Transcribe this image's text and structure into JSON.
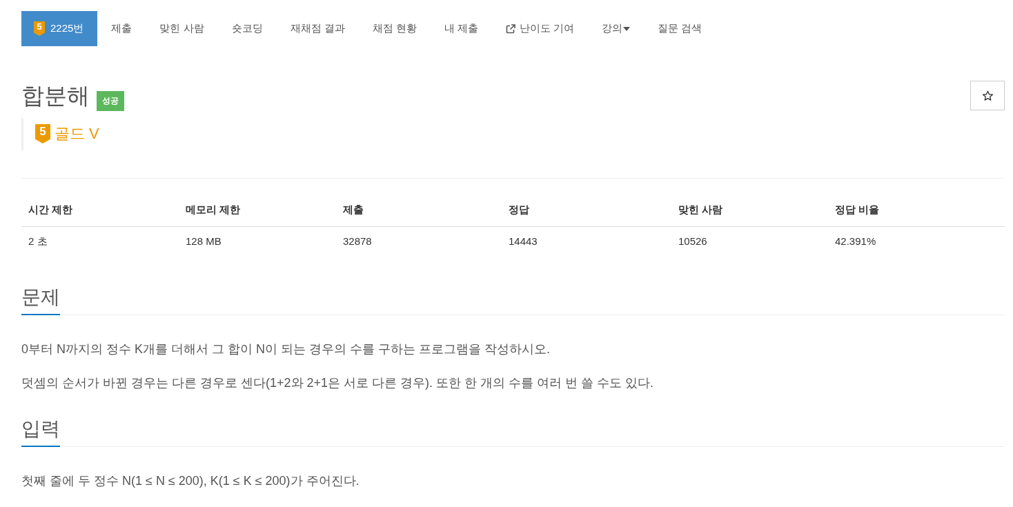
{
  "nav": {
    "tabs": [
      {
        "label": "2225번",
        "badge": "5",
        "kind": "problem",
        "selected": true
      },
      {
        "label": "제출",
        "kind": "link",
        "selected": false
      },
      {
        "label": "맞힌 사람",
        "kind": "link",
        "selected": false
      },
      {
        "label": "숏코딩",
        "kind": "link",
        "selected": false
      },
      {
        "label": "재채점 결과",
        "kind": "link",
        "selected": false
      },
      {
        "label": "채점 현황",
        "kind": "link",
        "selected": false
      },
      {
        "label": "내 제출",
        "kind": "link",
        "selected": false
      },
      {
        "label": "난이도 기여",
        "kind": "external",
        "selected": false
      },
      {
        "label": "강의",
        "kind": "dropdown",
        "selected": false
      },
      {
        "label": "질문 검색",
        "kind": "link",
        "selected": false
      }
    ]
  },
  "problem": {
    "title": "합분해",
    "result": "성공",
    "starred": false,
    "tier": {
      "badge": "5",
      "name": "골드 V"
    }
  },
  "info_table": {
    "columns": [
      "시간 제한",
      "메모리 제한",
      "제출",
      "정답",
      "맞힌 사람",
      "정답 비율"
    ],
    "rows": [
      [
        "2 초",
        "128 MB",
        "32878",
        "14443",
        "10526",
        "42.391%"
      ]
    ]
  },
  "sections": [
    {
      "heading": "문제",
      "paragraphs": [
        "0부터 N까지의 정수 K개를 더해서 그 합이 N이 되는 경우의 수를 구하는 프로그램을 작성하시오.",
        "덧셈의 순서가 바뀐 경우는 다른 경우로 센다(1+2와 2+1은 서로 다른 경우). 또한 한 개의 수를 여러 번 쓸 수도 있다."
      ]
    },
    {
      "heading": "입력",
      "paragraphs": [
        "첫째 줄에 두 정수 N(1 ≤ N ≤ 200), K(1 ≤ K ≤ 200)가 주어진다."
      ]
    }
  ]
}
